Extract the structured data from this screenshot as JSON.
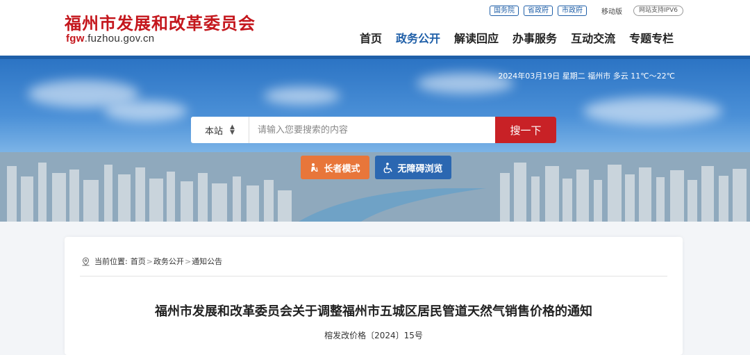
{
  "header": {
    "site_title": "福州市发展和改革委员会",
    "domain_prefix": "fgw",
    "domain_rest": ".fuzhou.gov.cn",
    "top_links": [
      "国务院",
      "省政府",
      "市政府"
    ],
    "mobile_label": "移动版",
    "ipv6_label": "网站支持IPV6"
  },
  "nav": [
    {
      "label": "首页",
      "active": false
    },
    {
      "label": "政务公开",
      "active": true
    },
    {
      "label": "解读回应",
      "active": false
    },
    {
      "label": "办事服务",
      "active": false
    },
    {
      "label": "互动交流",
      "active": false
    },
    {
      "label": "专题专栏",
      "active": false
    }
  ],
  "banner": {
    "weather": "2024年03月19日 星期二 福州市 多云 11℃～22℃"
  },
  "search": {
    "scope": "本站",
    "placeholder": "请输入您要搜索的内容",
    "button": "搜一下"
  },
  "modes": {
    "elder": "长者模式",
    "accessible": "无障碍浏览"
  },
  "breadcrumb": {
    "prefix": "当前位置:",
    "items": [
      "首页",
      "政务公开",
      "通知公告"
    ]
  },
  "article": {
    "title": "福州市发展和改革委员会关于调整福州市五城区居民管道天然气销售价格的通知",
    "doc_number": "榕发改价格〔2024〕15号"
  },
  "colors": {
    "brand_red": "#c4161c",
    "nav_blue": "#1f5fa8",
    "elder_orange": "#e8763a",
    "search_red": "#c82126"
  },
  "icons": [
    "location-pin-icon",
    "elder-icon",
    "wheelchair-icon",
    "chevron-updown-icon"
  ]
}
